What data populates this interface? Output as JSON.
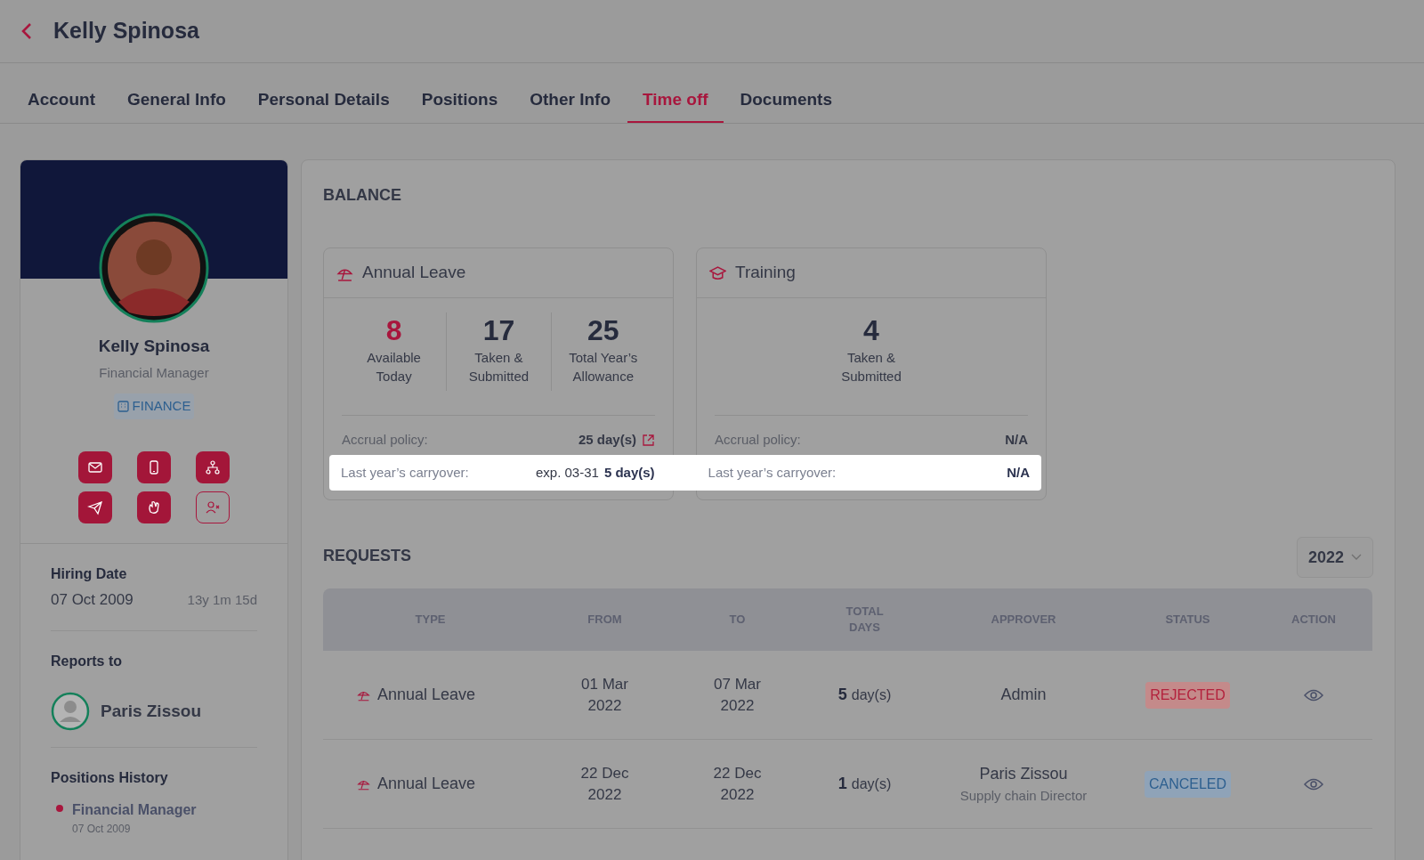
{
  "header": {
    "title": "Kelly Spinosa"
  },
  "tabs": [
    {
      "label": "Account",
      "selected": false
    },
    {
      "label": "General Info",
      "selected": false
    },
    {
      "label": "Personal Details",
      "selected": false
    },
    {
      "label": "Positions",
      "selected": false
    },
    {
      "label": "Other Info",
      "selected": false
    },
    {
      "label": "Time off",
      "selected": true
    },
    {
      "label": "Documents",
      "selected": false
    }
  ],
  "profile": {
    "name": "Kelly Spinosa",
    "job_title": "Financial Manager",
    "department": "FINANCE",
    "actions": [
      {
        "kind": "filled"
      },
      {
        "kind": "filled"
      },
      {
        "kind": "filled"
      },
      {
        "kind": "filled"
      },
      {
        "kind": "filled"
      },
      {
        "kind": "outline"
      }
    ]
  },
  "hiring": {
    "label": "Hiring Date",
    "date": "07 Oct 2009",
    "tenure": "13y 1m 15d"
  },
  "reports_to": {
    "label": "Reports to",
    "name": "Paris Zissou"
  },
  "positions_history": {
    "label": "Positions History",
    "items": [
      {
        "title": "Financial Manager",
        "date": "07 Oct 2009"
      }
    ]
  },
  "balance": {
    "title": "BALANCE",
    "cards": [
      {
        "kind": "annual",
        "title": "Annual Leave",
        "stats": [
          {
            "value": "8",
            "label": "Available Today",
            "highlight": true
          },
          {
            "value": "17",
            "label": "Taken & Submitted",
            "highlight": false
          },
          {
            "value": "25",
            "label": "Total Year’s Allowance",
            "highlight": false
          }
        ],
        "accrual_label": "Accrual policy:",
        "accrual_value": "25 day(s)",
        "accrual_link": true,
        "carryover_label": "Last year’s carryover:",
        "carryover_expiry": "exp. 03-31",
        "carryover_value": "5 day(s)"
      },
      {
        "kind": "training",
        "title": "Training",
        "stats": [
          {
            "value": "4",
            "label": "Taken & Submitted",
            "highlight": false
          }
        ],
        "accrual_label": "Accrual policy:",
        "accrual_value": "N/A",
        "accrual_link": false,
        "carryover_label": "Last year’s carryover:",
        "carryover_value": "N/A"
      }
    ]
  },
  "requests": {
    "title": "REQUESTS",
    "year": "2022",
    "columns": [
      "TYPE",
      "FROM",
      "TO",
      "TOTAL DAYS",
      "APPROVER",
      "STATUS",
      "ACTION"
    ],
    "rows": [
      {
        "type": "Annual Leave",
        "from": "01 Mar 2022",
        "to": "07 Mar 2022",
        "days": "5",
        "days_unit": "day(s)",
        "approver": "Admin",
        "status": "REJECTED",
        "kind": "rejected"
      },
      {
        "type": "Annual Leave",
        "from": "22 Dec 2022",
        "to": "22 Dec 2022",
        "days": "1",
        "days_unit": "day(s)",
        "approver": "Paris Zissou",
        "approver_title": "Supply chain Director",
        "status": "CANCELED",
        "kind": "canceled"
      }
    ]
  }
}
